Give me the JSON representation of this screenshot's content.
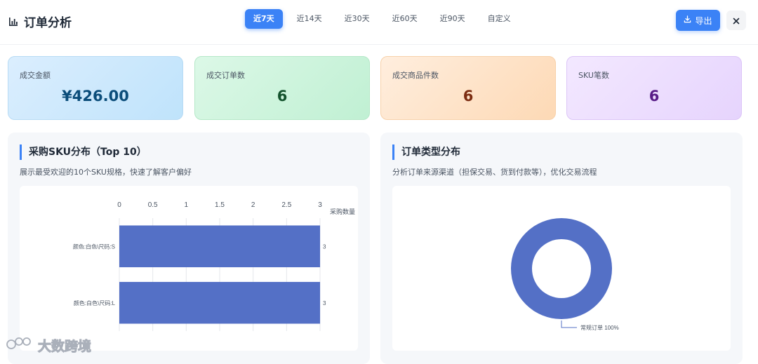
{
  "header": {
    "title": "订单分析",
    "tabs": [
      {
        "label": "近7天",
        "active": true
      },
      {
        "label": "近14天",
        "active": false
      },
      {
        "label": "近30天",
        "active": false
      },
      {
        "label": "近60天",
        "active": false
      },
      {
        "label": "近90天",
        "active": false
      },
      {
        "label": "自定义",
        "active": false
      }
    ],
    "export_label": "导出"
  },
  "metrics": [
    {
      "label": "成交金额",
      "value": "¥426.00"
    },
    {
      "label": "成交订单数",
      "value": "6"
    },
    {
      "label": "成交商品件数",
      "value": "6"
    },
    {
      "label": "SKU笔数",
      "value": "6"
    }
  ],
  "panels": {
    "sku": {
      "title": "采购SKU分布（Top 10）",
      "subtitle": "展示最受欢迎的10个SKU规格，快速了解客户偏好"
    },
    "order_type": {
      "title": "订单类型分布",
      "subtitle": "分析订单来源渠道（担保交易、货到付款等），优化交易流程"
    }
  },
  "chart_data": [
    {
      "type": "bar",
      "orientation": "horizontal",
      "categories": [
        "颜色:白色\\尺码:S",
        "颜色:白色\\尺码:L"
      ],
      "values": [
        3,
        3
      ],
      "axis_name": "采购数量",
      "xlim": [
        0,
        3
      ],
      "ticks": [
        "0",
        "0.5",
        "1",
        "1.5",
        "2",
        "2.5",
        "3"
      ],
      "data_labels": [
        "3",
        "3"
      ],
      "color": "#5470c6",
      "grid": true
    },
    {
      "type": "pie",
      "variant": "donut",
      "slices": [
        {
          "name": "常规订单",
          "value": 100,
          "label": "常规订单 100%"
        }
      ],
      "color": "#5470c6"
    }
  ],
  "watermark": "大数跨境",
  "colors": {
    "accent": "#3b82f6",
    "series": "#5470c6"
  }
}
